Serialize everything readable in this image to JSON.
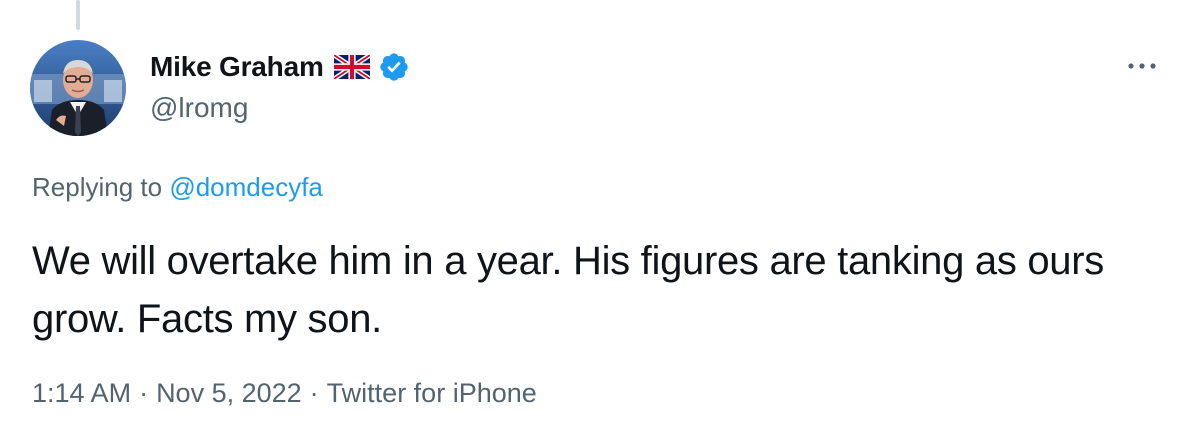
{
  "user": {
    "display_name": "Mike Graham",
    "handle": "@lromg",
    "flag_icon": "uk-flag-icon",
    "verified_icon": "verified-badge-icon",
    "verified_color": "#1d9bf0"
  },
  "reply": {
    "prefix": "Replying to",
    "target_handle": "@domdecyfa"
  },
  "tweet": {
    "text": "We will overtake him in a year. His figures are tanking as ours grow. Facts my son."
  },
  "meta": {
    "time": "1:14 AM",
    "separator": "·",
    "date": "Nov 5, 2022",
    "source": "Twitter for iPhone"
  },
  "colors": {
    "text_primary": "#0f1419",
    "text_secondary": "#536471",
    "link": "#1d9bf0"
  },
  "icons": {
    "more": "more-dots-icon"
  }
}
